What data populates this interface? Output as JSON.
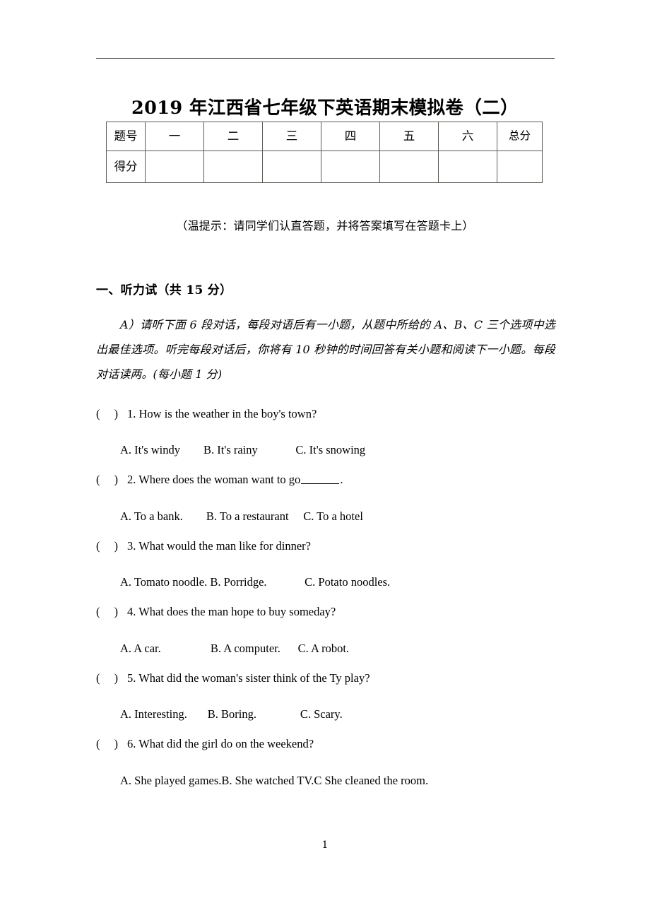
{
  "document": {
    "title": "2019 年江西省七年级下英语期末模拟卷（二）",
    "page_number": "1",
    "tip_note": "（温提示：请同学们认直答题，并将答案填写在答题卡上）"
  },
  "score_table": {
    "row_labels": [
      "题号",
      "得分"
    ],
    "columns": [
      "一",
      "二",
      "三",
      "四",
      "五",
      "六",
      "总分"
    ],
    "scores": [
      "",
      "",
      "",
      "",
      "",
      "",
      ""
    ]
  },
  "section": {
    "heading": "一、听力试（共 15 分）",
    "directions": "A）请听下面 6 段对话，每段对语后有一小题，从题中所给的 A、B、C 三个选项中选出最佳选项。听完每段对话后，你将有 10 秒钟的时间回答有关小题和阅读下一小题。每段对话读两。(每小题 1 分)"
  },
  "questions": [
    {
      "bracket_open": "(",
      "bracket_close": ")",
      "number": "1.",
      "stem": "How is the weather in the boy's town?",
      "stem_tail": "",
      "has_blank": false,
      "options": "A. It's windy        B. It's rainy             C. It's snowing"
    },
    {
      "bracket_open": "(",
      "bracket_close": ")",
      "number": "2.",
      "stem": "Where does the woman want to go",
      "stem_tail": ".",
      "has_blank": true,
      "options": "A. To a bank.        B. To a restaurant     C. To a hotel"
    },
    {
      "bracket_open": "(",
      "bracket_close": ")",
      "number": "3.",
      "stem": "What would the man like for dinner?",
      "stem_tail": "",
      "has_blank": false,
      "options": "A. Tomato noodle. B. Porridge.             C. Potato noodles."
    },
    {
      "bracket_open": "(",
      "bracket_close": ")",
      "number": "4.",
      "stem": "What does the man hope to buy someday?",
      "stem_tail": "",
      "has_blank": false,
      "options": "A. A car.                 B. A computer.      C. A robot."
    },
    {
      "bracket_open": "(",
      "bracket_close": ")",
      "number": "5.",
      "stem": "What did the woman's sister think of the Ty play?",
      "stem_tail": "",
      "has_blank": false,
      "options": "A. Interesting.       B. Boring.               C. Scary."
    },
    {
      "bracket_open": "(",
      "bracket_close": ")",
      "number": "6.",
      "stem": "What did the girl do on the weekend?",
      "stem_tail": "",
      "has_blank": false,
      "options": "A. She played games.B. She watched TV.C She cleaned the room."
    }
  ]
}
